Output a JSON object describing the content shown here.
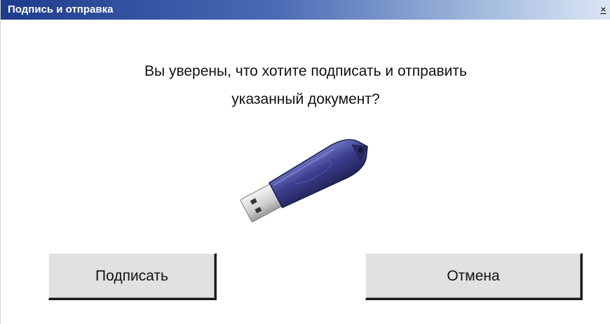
{
  "window": {
    "title": "Подпись и отправка",
    "close_glyph": "×"
  },
  "message": {
    "line1": "Вы уверены, что хотите подписать и отправить",
    "line2": "указанный документ?"
  },
  "image": {
    "icon": "usb-token-icon",
    "colors": {
      "body": "#3b3e8c",
      "connector": "#d8d8d8"
    }
  },
  "buttons": {
    "sign_label": "Подписать",
    "cancel_label": "Отмена"
  }
}
